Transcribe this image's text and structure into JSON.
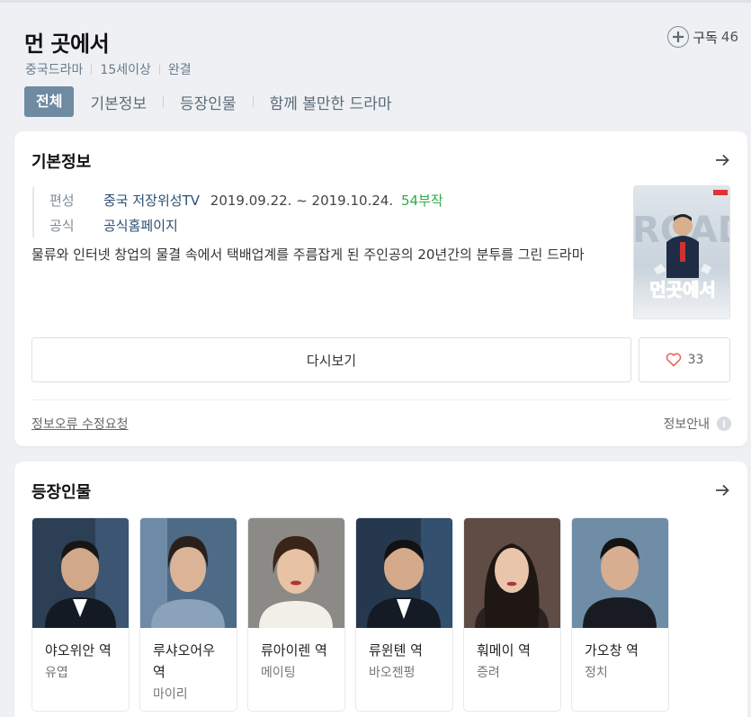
{
  "header": {
    "title": "먼 곳에서",
    "subscribe_label": "구독",
    "subscribe_count": "46",
    "meta": [
      "중국드라마",
      "15세이상",
      "완결"
    ],
    "tabs": [
      "전체",
      "기본정보",
      "등장인물",
      "함께 볼만한 드라마"
    ]
  },
  "basic_info": {
    "title": "기본정보",
    "rows": [
      {
        "key": "편성",
        "channel": "중국 저장위성TV",
        "period": "2019.09.22. ~ 2019.10.24.",
        "episodes": "54부작"
      },
      {
        "key": "공식",
        "link": "공식홈페이지"
      }
    ],
    "description": "물류와 인터넷 창업의 물결 속에서 택배업계를 주름잡게 된 주인공의 20년간의 분투를 그린 드라마",
    "poster_title": "먼곳에서",
    "rewatch_label": "다시보기",
    "like_count": "33",
    "report_label": "정보오류 수정요청",
    "guide_label": "정보안내"
  },
  "cast_section": {
    "title": "등장인물",
    "items": [
      {
        "role": "야오위안 역",
        "actor": "유엽"
      },
      {
        "role": "루샤오어우 역",
        "actor": "마이리"
      },
      {
        "role": "류아이렌 역",
        "actor": "메이팅"
      },
      {
        "role": "류윈톈 역",
        "actor": "바오젠펑"
      },
      {
        "role": "훠메이 역",
        "actor": "증려"
      },
      {
        "role": "가오창 역",
        "actor": "정치"
      }
    ]
  },
  "colors": {
    "active_tab": "#6f8ba2",
    "link": "#2b4f72",
    "episodes_green": "#2faa48",
    "heart": "#e5675f"
  }
}
